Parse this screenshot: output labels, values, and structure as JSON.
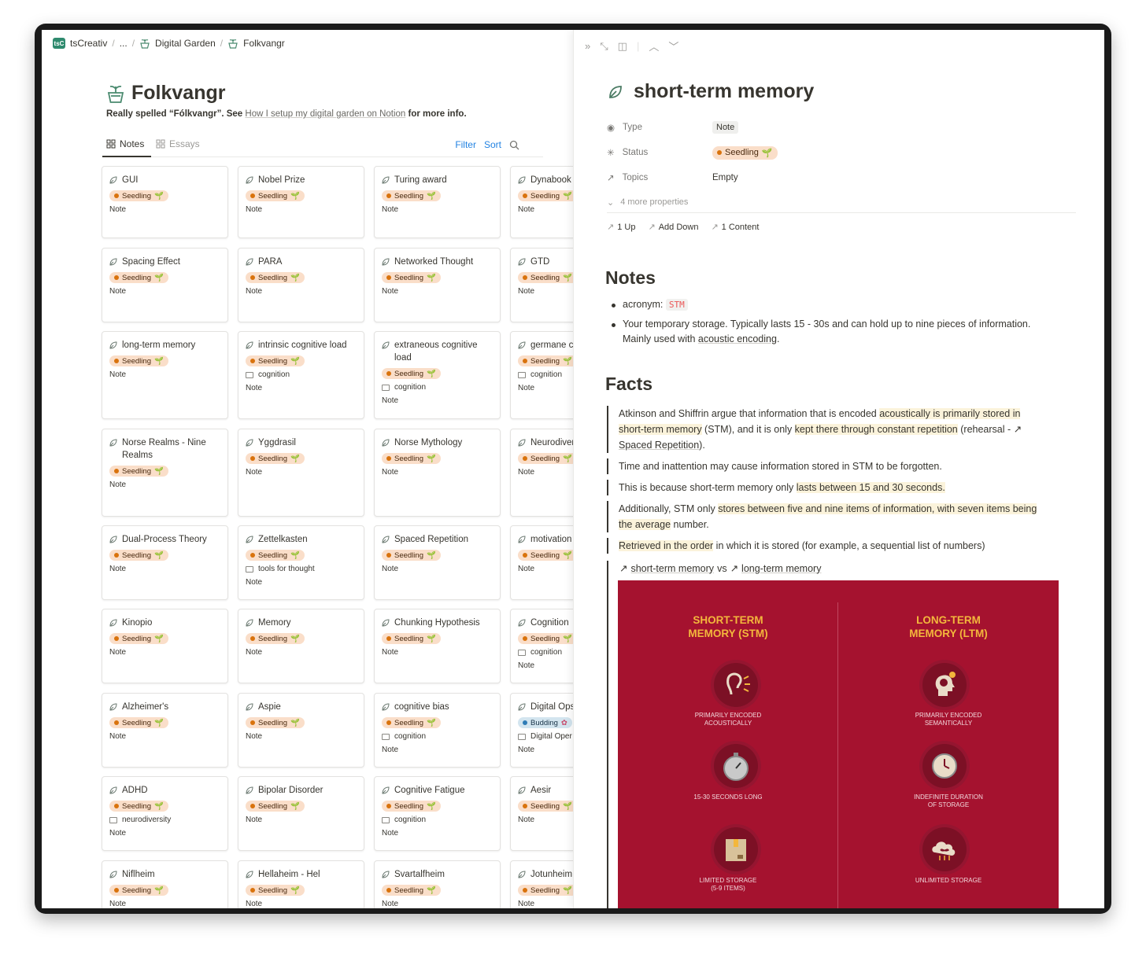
{
  "breadcrumb": {
    "workspace": "tsCreativ",
    "workspace_icon": "tsC",
    "ellipsis": "...",
    "parent": "Digital Garden",
    "current": "Folkvangr"
  },
  "page": {
    "title": "Folkvangr",
    "desc_prefix": "Really spelled “Fólkvangr”. See ",
    "desc_link": "How I setup my digital garden on Notion",
    "desc_suffix": " for more info."
  },
  "tabs": {
    "notes": "Notes",
    "essays": "Essays"
  },
  "toolbar": {
    "filter": "Filter",
    "sort": "Sort"
  },
  "cards": [
    {
      "title": "GUI",
      "status": "Seedling",
      "type": "Note"
    },
    {
      "title": "Nobel Prize",
      "status": "Seedling",
      "type": "Note"
    },
    {
      "title": "Turing award",
      "status": "Seedling",
      "type": "Note"
    },
    {
      "title": "Dynabook",
      "status": "Seedling",
      "type": "Note"
    },
    {
      "title": "Spacing Effect",
      "status": "Seedling",
      "type": "Note"
    },
    {
      "title": "PARA",
      "status": "Seedling",
      "type": "Note"
    },
    {
      "title": "Networked Thought",
      "status": "Seedling",
      "type": "Note"
    },
    {
      "title": "GTD",
      "status": "Seedling",
      "type": "Note"
    },
    {
      "title": "long-term memory",
      "status": "Seedling",
      "type": "Note"
    },
    {
      "title": "intrinsic cognitive load",
      "status": "Seedling",
      "topic": "cognition",
      "type": "Note"
    },
    {
      "title": "extraneous cognitive load",
      "status": "Seedling",
      "topic": "cognition",
      "type": "Note"
    },
    {
      "title": "germane c",
      "status": "Seedling",
      "topic": "cognition",
      "type": "Note"
    },
    {
      "title": "Norse Realms - Nine Realms",
      "status": "Seedling",
      "type": "Note"
    },
    {
      "title": "Yggdrasil",
      "status": "Seedling",
      "type": "Note"
    },
    {
      "title": "Norse Mythology",
      "status": "Seedling",
      "type": "Note"
    },
    {
      "title": "Neurodiver",
      "status": "Seedling",
      "type": "Note"
    },
    {
      "title": "Dual-Process Theory",
      "status": "Seedling",
      "type": "Note"
    },
    {
      "title": "Zettelkasten",
      "status": "Seedling",
      "topic": "tools for thought",
      "type": "Note"
    },
    {
      "title": "Spaced Repetition",
      "status": "Seedling",
      "type": "Note"
    },
    {
      "title": "motivation compensat",
      "status": "Seedling",
      "type": "Note"
    },
    {
      "title": "Kinopio",
      "status": "Seedling",
      "type": "Note"
    },
    {
      "title": "Memory",
      "status": "Seedling",
      "type": "Note"
    },
    {
      "title": "Chunking Hypothesis",
      "status": "Seedling",
      "type": "Note"
    },
    {
      "title": "Cognition",
      "status": "Seedling",
      "topic": "cognition",
      "type": "Note"
    },
    {
      "title": "Alzheimer's",
      "status": "Seedling",
      "type": "Note"
    },
    {
      "title": "Aspie",
      "status": "Seedling",
      "type": "Note"
    },
    {
      "title": "cognitive bias",
      "status": "Seedling",
      "topic": "cognition",
      "type": "Note"
    },
    {
      "title": "Digital Ops",
      "status": "Budding",
      "topic": "Digital Oper",
      "type": "Note"
    },
    {
      "title": "ADHD",
      "status": "Seedling",
      "topic": "neurodiversity",
      "type": "Note"
    },
    {
      "title": "Bipolar Disorder",
      "status": "Seedling",
      "type": "Note"
    },
    {
      "title": "Cognitive Fatigue",
      "status": "Seedling",
      "topic": "cognition",
      "type": "Note"
    },
    {
      "title": "Aesir",
      "status": "Seedling",
      "type": "Note"
    },
    {
      "title": "Niflheim",
      "status": "Seedling",
      "type": "Note"
    },
    {
      "title": "Hellaheim - Hel",
      "status": "Seedling",
      "type": "Note"
    },
    {
      "title": "Svartalfheim",
      "status": "Seedling",
      "type": "Note"
    },
    {
      "title": "Jotunheim",
      "status": "Seedling",
      "type": "Note"
    }
  ],
  "peek": {
    "title": "short-term memory",
    "props": {
      "type_label": "Type",
      "type_value": "Note",
      "status_label": "Status",
      "status_value": "Seedling",
      "topics_label": "Topics",
      "topics_value": "Empty",
      "more": "4 more properties"
    },
    "relations": {
      "up": "1 Up",
      "down": "Add Down",
      "content": "1 Content"
    },
    "notes_heading": "Notes",
    "acronym_label": "acronym:",
    "acronym": "STM",
    "bullet2_a": "Your temporary storage. Typically lasts 15 - 30s and can hold up to nine pieces of information. Mainly used with ",
    "bullet2_link": "acoustic encoding",
    "bullet2_b": ".",
    "facts_heading": "Facts",
    "f1_a": "Atkinson and Shiffrin argue that information that is encoded ",
    "f1_b": "acoustically is primarily stored in short-term memory",
    "f1_c": " (STM), and it is only ",
    "f1_d": "kept there through constant repetition",
    "f1_e": " (rehearsal - ",
    "f1_link": "Spaced Repetition",
    "f1_f": ").",
    "f2": "Time and inattention may cause information stored in STM to be forgotten.",
    "f3_a": "This is because short-term memory only ",
    "f3_b": "lasts between 15 and 30 seconds.",
    "f4_a": "Additionally, STM only ",
    "f4_b": "stores between five and nine items of information, with seven items being the average",
    "f4_c": " number.",
    "f5_a": "Retrieved in the order",
    "f5_b": " in which it is stored (for example, a sequential list of numbers)",
    "cmp_a": "short-term memory",
    "cmp_vs": "vs",
    "cmp_b": "long-term memory",
    "inf": {
      "stm_title_1": "SHORT-TERM",
      "stm_title_2": "MEMORY (STM)",
      "ltm_title_1": "LONG-TERM",
      "ltm_title_2": "MEMORY (LTM)",
      "stm_1_a": "PRIMARILY ENCODED",
      "stm_1_b": "ACOUSTICALLY",
      "stm_2": "15-30 SECONDS LONG",
      "stm_3_a": "LIMITED STORAGE",
      "stm_3_b": "(5-9 ITEMS)",
      "ltm_1_a": "PRIMARILY ENCODED",
      "ltm_1_b": "SEMANTICALLY",
      "ltm_2_a": "INDEFINITE DURATION",
      "ltm_2_b": "OF STORAGE",
      "ltm_3": "UNLIMITED STORAGE"
    }
  }
}
